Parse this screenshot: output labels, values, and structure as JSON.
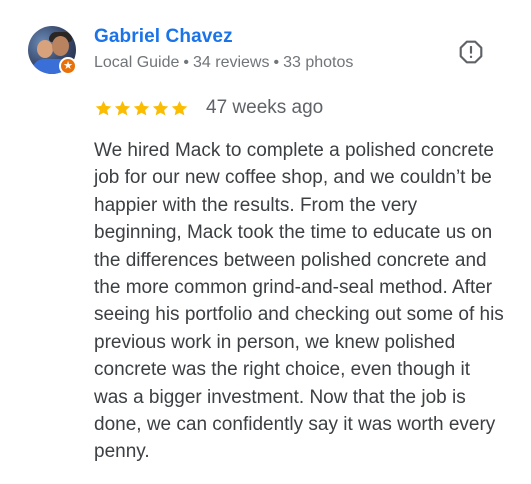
{
  "reviewer": {
    "name": "Gabriel Chavez",
    "badge": "Local Guide",
    "reviews": "34 reviews",
    "photos": "33 photos",
    "separator": "•"
  },
  "rating": {
    "stars": 5,
    "max_stars": 5,
    "time": "47 weeks ago"
  },
  "review_text": "We hired Mack to complete a polished concrete job for our new coffee shop, and we couldn’t be happier with the results. From the very beginning, Mack took the time to educate us on the differences between polished concrete and the more common grind-and-seal method. After seeing his portfolio and checking out some of his previous work in person, we knew polished concrete was the right choice, even though it was a bigger investment. Now that the job is done, we can confidently say it was worth every penny.",
  "icons": {
    "flag": "report-flag-icon",
    "badge": "local-guide-star-icon",
    "star": "star-icon"
  },
  "colors": {
    "name": "#1a73e8",
    "star": "#fbbc04",
    "meta": "#70757a",
    "body_text": "#3c4043",
    "badge": "#e8710a"
  }
}
